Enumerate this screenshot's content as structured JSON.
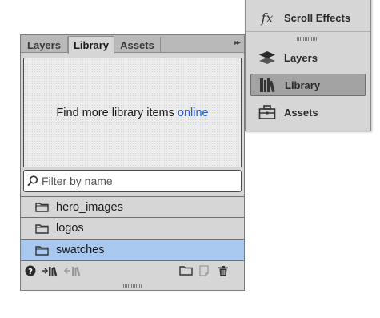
{
  "side_menu": {
    "items": [
      {
        "label": "Scroll Effects",
        "icon": "fx-icon",
        "active": false
      },
      {
        "label": "Layers",
        "icon": "layers-icon",
        "active": false
      },
      {
        "label": "Library",
        "icon": "library-icon",
        "active": true
      },
      {
        "label": "Assets",
        "icon": "briefcase-icon",
        "active": false
      }
    ],
    "fx_glyph": "fx"
  },
  "panel": {
    "tabs": [
      {
        "label": "Layers",
        "active": false
      },
      {
        "label": "Library",
        "active": true
      },
      {
        "label": "Assets",
        "active": false
      }
    ],
    "collapse_glyph": "▸▸",
    "preview": {
      "text": "Find more library items",
      "link": "online"
    },
    "filter": {
      "placeholder": "Filter by name",
      "value": ""
    },
    "folders": [
      {
        "name": "hero_images",
        "selected": false
      },
      {
        "name": "logos",
        "selected": false
      },
      {
        "name": "swatches",
        "selected": true
      }
    ],
    "selection_color": "#a9c8ef",
    "link_color": "#1f5fd6",
    "bottom_icons": [
      "help-icon",
      "import-icon",
      "export-icon",
      "new-folder-icon",
      "new-item-icon",
      "trash-icon"
    ]
  }
}
